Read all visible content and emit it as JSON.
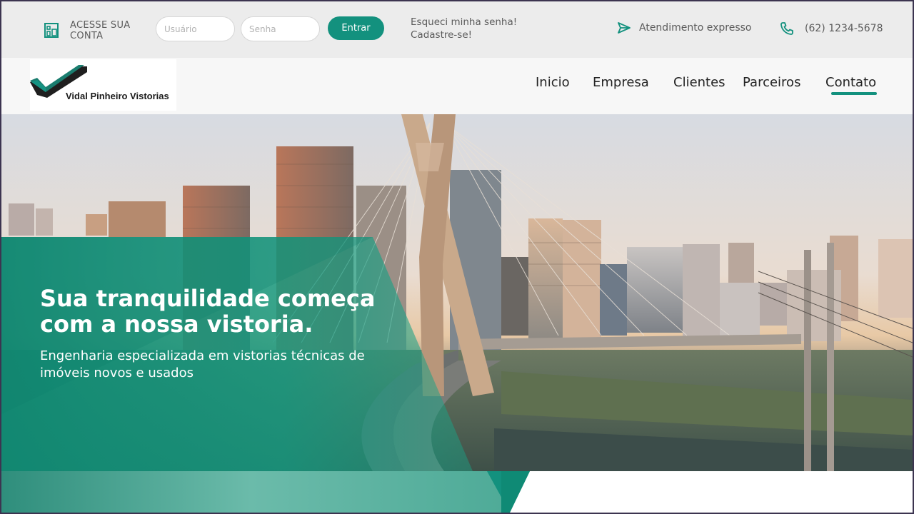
{
  "topbar": {
    "login_label": "ACESSE SUA CONTA",
    "username_placeholder": "Usuário",
    "password_placeholder": "Senha",
    "enter_button": "Entrar",
    "forgot_password": "Esqueci minha senha!",
    "signup": "Cadastre-se!",
    "express_service": "Atendimento expresso",
    "phone": "(62) 1234-5678"
  },
  "nav": {
    "logo_text": "Vidal Pinheiro Vistorias",
    "items": [
      "Inicio",
      "Empresa",
      "Clientes",
      "Parceiros",
      "Contato"
    ],
    "active": "Contato"
  },
  "hero": {
    "title": "Sua tranquilidade começa com a nossa vistoria.",
    "subtitle": "Engenharia especializada em vistorias técnicas de imóveis novos e usados"
  },
  "colors": {
    "accent": "#13917e",
    "topbar_bg": "#ececec",
    "nav_bg": "#f7f7f7",
    "text": "#5b5b5b"
  },
  "icons": {
    "login": "building-login-icon",
    "express": "paper-plane-icon",
    "phone": "phone-icon"
  }
}
